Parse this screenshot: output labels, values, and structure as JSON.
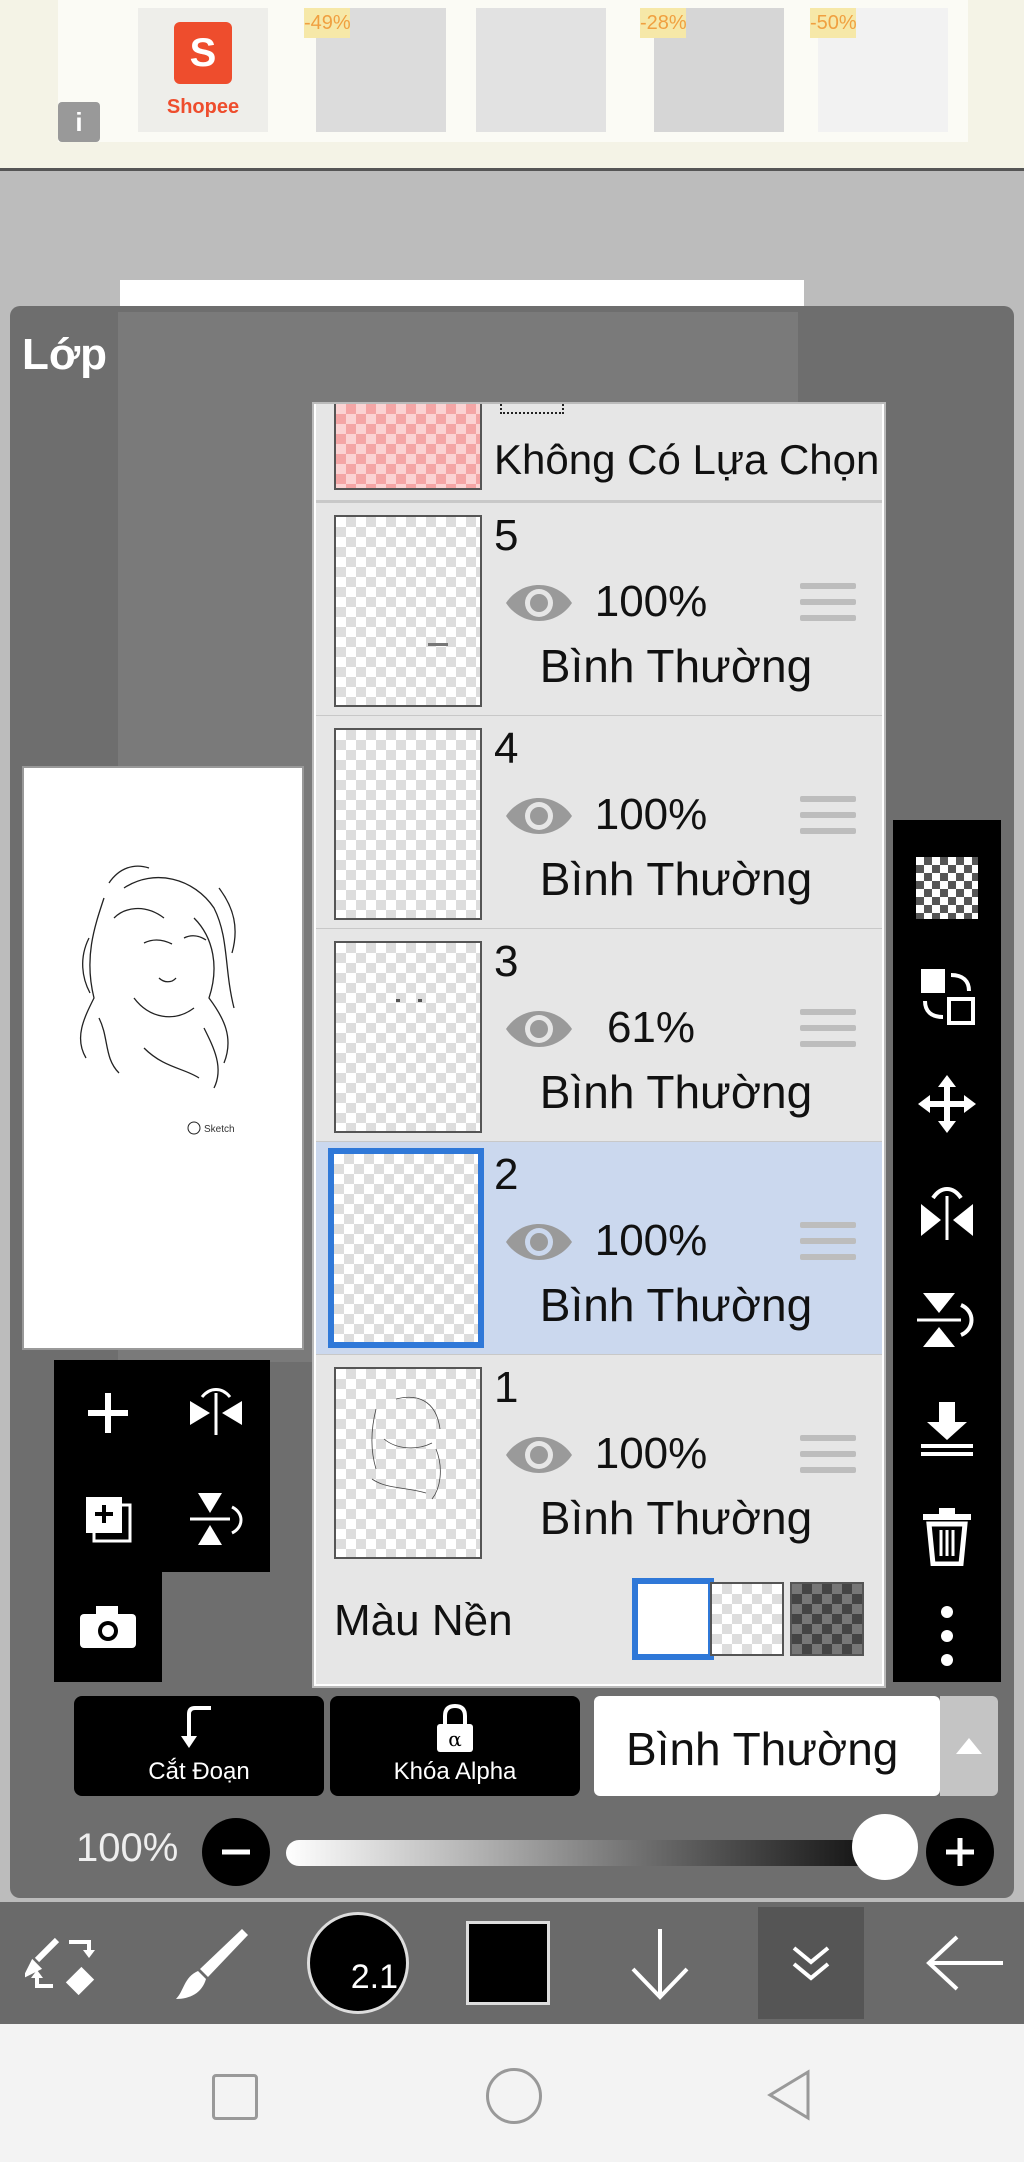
{
  "ad": {
    "brand": "Shopee",
    "badges": [
      "-49%",
      "-28%",
      "-50%"
    ],
    "info_icon": "info-icon"
  },
  "panel": {
    "title": "Lớp"
  },
  "selection_row": {
    "label": "Không Có Lựa Chọn"
  },
  "layers": [
    {
      "number": "5",
      "opacity": "100%",
      "blend": "Bình Thường",
      "visible": true,
      "selected": false
    },
    {
      "number": "4",
      "opacity": "100%",
      "blend": "Bình Thường",
      "visible": true,
      "selected": false
    },
    {
      "number": "3",
      "opacity": "61%",
      "blend": "Bình Thường",
      "visible": true,
      "selected": false
    },
    {
      "number": "2",
      "opacity": "100%",
      "blend": "Bình Thường",
      "visible": true,
      "selected": true
    },
    {
      "number": "1",
      "opacity": "100%",
      "blend": "Bình Thường",
      "visible": true,
      "selected": false
    }
  ],
  "background_row": {
    "label": "Màu Nền"
  },
  "bottom_panel": {
    "clip_label": "Cắt Đoạn",
    "alpha_label": "Khóa Alpha",
    "blend_mode": "Bình Thường",
    "opacity_label": "100%",
    "opacity_value": 1.0
  },
  "toolbar": {
    "brush_size": "2.1",
    "color": "#000000"
  },
  "colors": {
    "selected_border": "#2f78d8",
    "selected_row": "#cbd8ee",
    "panel_bg": "#6e6e6e"
  }
}
